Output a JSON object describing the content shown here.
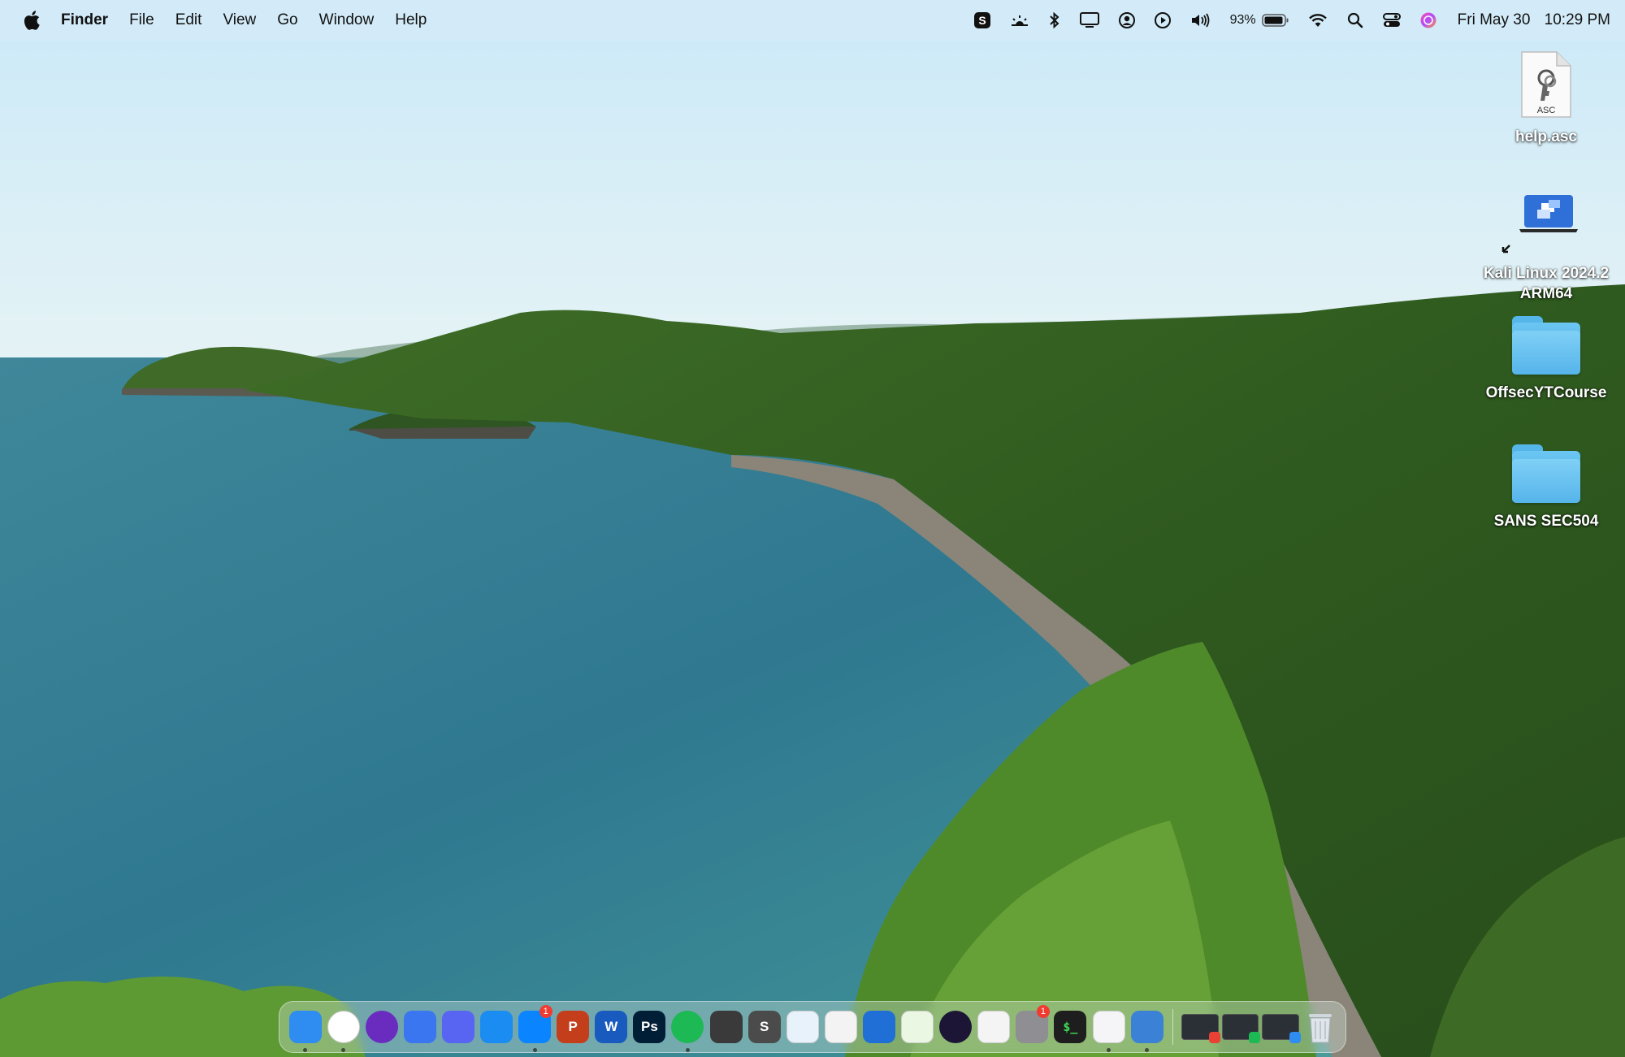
{
  "menubar": {
    "apple_icon": "apple-logo-icon",
    "app_name": "Finder",
    "menus": [
      "File",
      "Edit",
      "View",
      "Go",
      "Window",
      "Help"
    ],
    "battery_percent": "93%",
    "date": "Fri May 30",
    "time": "10:29 PM",
    "status_icons": [
      "skype-icon",
      "display-brightness-icon",
      "bluetooth-icon",
      "screen-mirroring-icon",
      "user-account-icon",
      "now-playing-icon",
      "volume-icon",
      "battery-icon",
      "wifi-icon",
      "spotlight-search-icon",
      "control-center-icon",
      "siri-icon"
    ]
  },
  "desktop": {
    "icons": [
      {
        "label": "help.asc",
        "type": "document",
        "file_badge": "ASC"
      },
      {
        "label": "Kali Linux 2024.2 ARM64",
        "type": "alias-vm"
      },
      {
        "label": "OffsecYTCourse",
        "type": "folder"
      },
      {
        "label": "SANS SEC504",
        "type": "folder"
      }
    ]
  },
  "dock": {
    "apps": [
      {
        "name": "finder-icon",
        "text": "",
        "color": "#2f8cf0",
        "running": true
      },
      {
        "name": "chrome-icon",
        "text": "",
        "color": "#ffffff",
        "running": true
      },
      {
        "name": "tor-browser-icon",
        "text": "",
        "color": "#6a2bbf",
        "running": false
      },
      {
        "name": "signal-icon",
        "text": "",
        "color": "#3a76f0",
        "running": false
      },
      {
        "name": "discord-icon",
        "text": "",
        "color": "#5865f2",
        "running": false
      },
      {
        "name": "shazam-icon",
        "text": "",
        "color": "#1b8cf2",
        "running": false
      },
      {
        "name": "messenger-icon",
        "text": "",
        "color": "#0a84ff",
        "running": true,
        "badge": "1"
      },
      {
        "name": "powerpoint-icon",
        "text": "P",
        "color": "#c43e1c",
        "running": false
      },
      {
        "name": "word-icon",
        "text": "W",
        "color": "#185abd",
        "running": false
      },
      {
        "name": "photoshop-icon",
        "text": "Ps",
        "color": "#001e36",
        "running": false
      },
      {
        "name": "spotify-icon",
        "text": "",
        "color": "#1db954",
        "running": true
      },
      {
        "name": "keyboard-app-icon",
        "text": "",
        "color": "#3a3a3a",
        "running": false
      },
      {
        "name": "sublime-text-icon",
        "text": "S",
        "color": "#4b4b4b",
        "running": false
      },
      {
        "name": "windows-app-icon",
        "text": "",
        "color": "#e8f2fb",
        "running": false
      },
      {
        "name": "vscode-icon",
        "text": "",
        "color": "#f3f3f3",
        "running": false
      },
      {
        "name": "xcode-icon",
        "text": "",
        "color": "#1f6fd6",
        "running": false
      },
      {
        "name": "cube-app-icon",
        "text": "",
        "color": "#eaf7e2",
        "running": false
      },
      {
        "name": "circle-app-icon",
        "text": "",
        "color": "#1c1536",
        "running": false
      },
      {
        "name": "final-cut-icon",
        "text": "",
        "color": "#f4f4f4",
        "running": false
      },
      {
        "name": "system-settings-icon",
        "text": "",
        "color": "#8e8e93",
        "running": false,
        "badge": "1"
      },
      {
        "name": "terminal-icon",
        "text": "$_",
        "color": "#1e1e1e",
        "running": false
      },
      {
        "name": "parallels-icon",
        "text": "",
        "color": "#f5f5f7",
        "running": true
      },
      {
        "name": "network-app-icon",
        "text": "",
        "color": "#3b82d6",
        "running": true
      }
    ],
    "minimized": [
      {
        "name": "minimized-chrome-window",
        "mini_color": "#e94235"
      },
      {
        "name": "minimized-spotify-window",
        "mini_color": "#1db954"
      },
      {
        "name": "minimized-finder-window",
        "mini_color": "#2f8cf0"
      }
    ],
    "trash_icon": "trash-icon"
  }
}
